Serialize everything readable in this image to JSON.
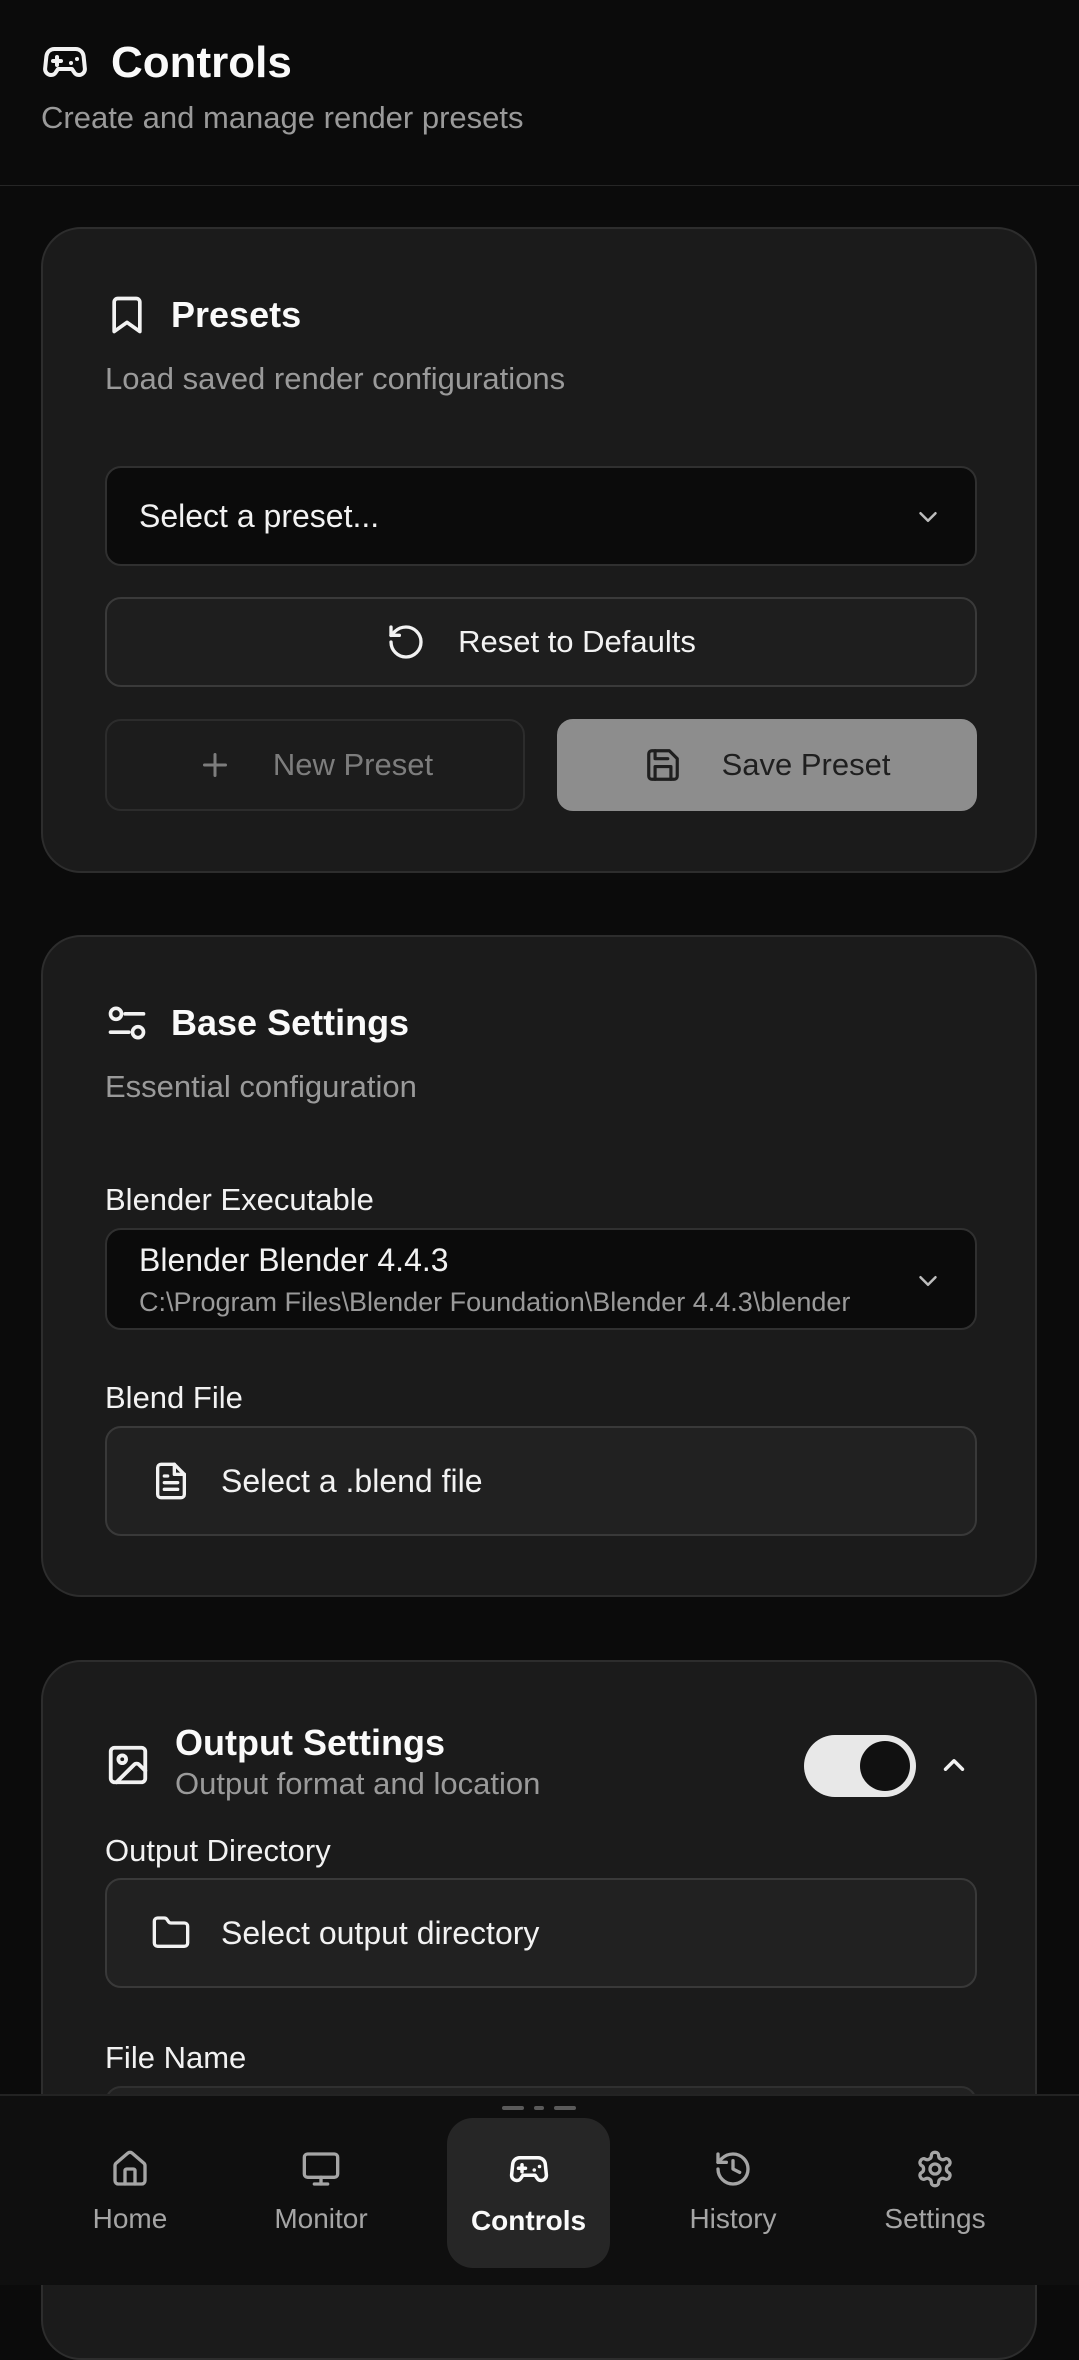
{
  "header": {
    "title": "Controls",
    "subtitle": "Create and manage render presets",
    "icon": "gamepad-icon"
  },
  "presets": {
    "title": "Presets",
    "subtitle": "Load saved render configurations",
    "select_placeholder": "Select a preset...",
    "reset_label": "Reset to Defaults",
    "new_label": "New Preset",
    "save_label": "Save Preset"
  },
  "base_settings": {
    "title": "Base Settings",
    "subtitle": "Essential configuration",
    "blender_label": "Blender Executable",
    "blender_name": "Blender Blender 4.4.3",
    "blender_path": "C:\\Program Files\\Blender Foundation\\Blender 4.4.3\\blender",
    "blend_file_label": "Blend File",
    "blend_file_button": "Select a .blend file"
  },
  "output_settings": {
    "title": "Output Settings",
    "subtitle": "Output format and location",
    "enabled": true,
    "output_dir_label": "Output Directory",
    "output_dir_button": "Select output directory",
    "file_name_label": "File Name"
  },
  "nav": {
    "items": [
      {
        "label": "Home",
        "icon": "home-icon"
      },
      {
        "label": "Monitor",
        "icon": "monitor-icon"
      },
      {
        "label": "Controls",
        "icon": "gamepad-icon",
        "active": true
      },
      {
        "label": "History",
        "icon": "history-icon"
      },
      {
        "label": "Settings",
        "icon": "gear-icon"
      }
    ]
  },
  "colors": {
    "background": "#0b0b0b",
    "card": "#1b1b1b",
    "accent": "#fafafa",
    "muted": "#9a9a9a"
  }
}
